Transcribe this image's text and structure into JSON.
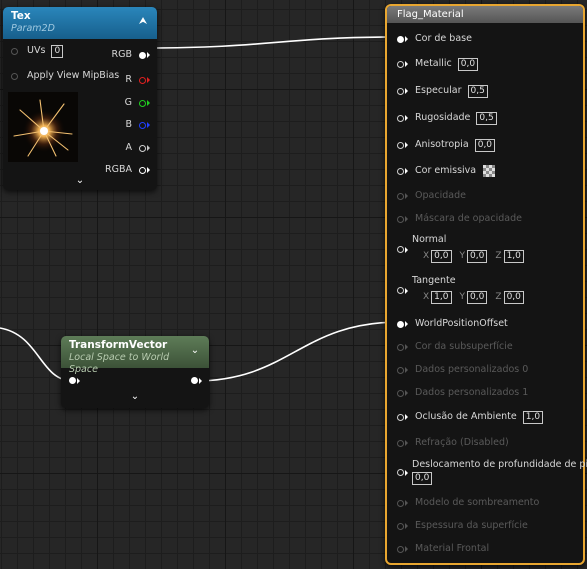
{
  "tex_node": {
    "title": "Tex",
    "subtitle": "Param2D",
    "collapse_icon": "chevron-up-icon",
    "inputs": [
      {
        "label": "UVs",
        "value": "0"
      },
      {
        "label": "Apply View MipBias"
      }
    ],
    "outputs": [
      {
        "label": "RGB",
        "color": "#ffffff"
      },
      {
        "label": "R",
        "color": "#e02020"
      },
      {
        "label": "G",
        "color": "#20d020"
      },
      {
        "label": "B",
        "color": "#2040ff"
      },
      {
        "label": "A",
        "color": "#c8c8c8"
      },
      {
        "label": "RGBA",
        "color": "#ffffff"
      }
    ],
    "preview_icon": "sparkle-texture-thumbnail",
    "expand_icon": "chevron-down-icon"
  },
  "transform_node": {
    "title": "TransformVector",
    "subtitle": "Local Space to World Space",
    "collapse_icon": "chevron-down-icon",
    "expand_icon": "chevron-down-icon"
  },
  "material_node": {
    "title": "Flag_Material",
    "border_color": "#e8a630",
    "pins": [
      {
        "label": "Cor de base"
      },
      {
        "label": "Metallic",
        "value": "0,0"
      },
      {
        "label": "Especular",
        "value": "0,5"
      },
      {
        "label": "Rugosidade",
        "value": "0,5"
      },
      {
        "label": "Anisotropia",
        "value": "0,0"
      },
      {
        "label": "Cor emissiva"
      },
      {
        "label": "Opacidade"
      },
      {
        "label": "Máscara de opacidade"
      },
      {
        "label": "Normal",
        "vector": {
          "x": "0,0",
          "y": "0,0",
          "z": "1,0"
        }
      },
      {
        "label": "Tangente",
        "vector": {
          "x": "1,0",
          "y": "0,0",
          "z": "0,0"
        }
      },
      {
        "label": "WorldPositionOffset"
      },
      {
        "label": "Cor da subsuperfície"
      },
      {
        "label": "Dados personalizados 0"
      },
      {
        "label": "Dados personalizados 1"
      },
      {
        "label": "Oclusão de Ambiente",
        "value": "1,0"
      },
      {
        "label": "Refração (Disabled)"
      },
      {
        "label": "Deslocamento de profundidade de pixel",
        "value": "0,0"
      },
      {
        "label": "Modelo de sombreamento"
      },
      {
        "label": "Espessura da superfície"
      },
      {
        "label": "Material Frontal"
      }
    ],
    "axis_labels": {
      "x": "X",
      "y": "Y",
      "z": "Z"
    }
  },
  "colors": {
    "tex_header": "#1d6fa0",
    "transform_header": "#4f6d4a",
    "material_header": "#6a6a6a",
    "wire": "#ffffff",
    "accent_orange": "#e8a630"
  }
}
